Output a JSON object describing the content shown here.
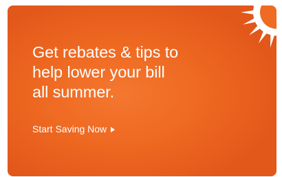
{
  "banner": {
    "headline_lines": [
      "Get rebates & tips to",
      "help lower your bill",
      "all summer."
    ],
    "cta_label": "Start Saving Now",
    "cta_icon": "triangle-right-icon",
    "decoration_icon": "sun-icon",
    "colors": {
      "background": "#ef6a22",
      "text": "#ffffff"
    }
  }
}
